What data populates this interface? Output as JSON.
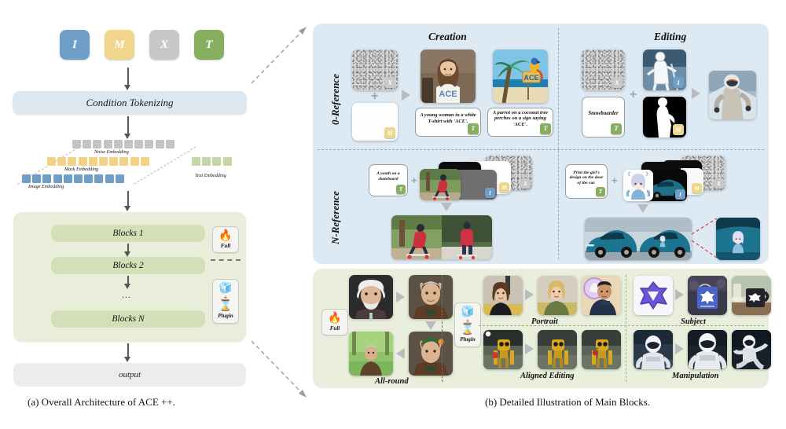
{
  "figure": {
    "caption_a": "(a) Overall Architecture of ACE ++.",
    "caption_b": "(b) Detailed Illustration of Main Blocks."
  },
  "architecture": {
    "tokens": [
      {
        "label": "I",
        "color": "#6f9fc8",
        "name": "image"
      },
      {
        "label": "M",
        "color": "#f0d58c",
        "name": "mask"
      },
      {
        "label": "X",
        "color": "#c8c8c8",
        "name": "noise"
      },
      {
        "label": "T",
        "color": "#85ae5e",
        "name": "text"
      }
    ],
    "condition_tokenizing": "Condition Tokenizing",
    "embeddings": [
      {
        "label": "Noise Embedding",
        "color": "#c3c3c3",
        "count": 10
      },
      {
        "label": "Mask Embedding",
        "color": "#f5d184",
        "count": 10
      },
      {
        "label": "Image Embedding",
        "color": "#6f9fc8",
        "count": 10
      },
      {
        "label": "Text Embedding",
        "color": "#c4d6a5",
        "count": 4
      }
    ],
    "blocks": [
      "Blocks 1",
      "Blocks 2",
      "...",
      "Blocks N"
    ],
    "output": "output",
    "badges": [
      {
        "label": "Full",
        "icons": [
          "🔥"
        ],
        "name": "full-finetune-badge"
      },
      {
        "label": "Plugin",
        "icons": [
          "🧊",
          "+",
          "⌛"
        ],
        "name": "plugin-badge"
      }
    ]
  },
  "detail": {
    "row_labels": [
      "0-Reference",
      "N-Reference"
    ],
    "column_titles": [
      "Creation",
      "Editing"
    ],
    "creation_zero_ref": {
      "inputs": [
        {
          "tag": "X",
          "tag_color": "#c8c8c8",
          "kind": "noise"
        },
        {
          "tag": "M",
          "tag_color": "#f0d58c",
          "kind": "white-mask"
        }
      ],
      "plus": "+",
      "results": [
        {
          "prompt": "A young woman in a white T-shirt with 'ACE'.",
          "tag": "T",
          "tag_color": "#85ae5e",
          "alt": "young woman in white ACE t-shirt"
        },
        {
          "prompt": "A parrot on a coconut tree perches on a sign saying 'ACE'.",
          "tag": "T",
          "tag_color": "#85ae5e",
          "alt": "parrot on coconut tree beach"
        }
      ]
    },
    "editing_zero_ref": {
      "inputs": [
        {
          "tag": "X",
          "tag_color": "#c8c8c8",
          "kind": "noise"
        },
        {
          "tag": "I",
          "tag_color": "#6f9fc8",
          "kind": "snowboarder-sketch"
        },
        {
          "tag": "T",
          "tag_color": "#85ae5e",
          "kind": "prompt",
          "prompt": "Snowboarder"
        },
        {
          "tag": "M",
          "tag_color": "#f0d58c",
          "kind": "binary-mask"
        }
      ],
      "plus": "+",
      "result_alt": "snowboarder with helmet and goggles"
    },
    "creation_n_ref": {
      "prompt": "A youth on a skateboard",
      "prompt_tag": "T",
      "plus": "+",
      "stack_tags": [
        "I",
        "M",
        "X"
      ],
      "result_alt": "skateboarder pair of generated frames"
    },
    "editing_n_ref": {
      "prompt": "Print the girl's design on the door of  the car.",
      "prompt_tag": "T",
      "plus": "+",
      "stack_tags": [
        "I",
        "M",
        "X"
      ],
      "result_alt": "blue sedan before and after decal with zoom inset"
    },
    "main_blocks": {
      "badges": [
        {
          "label": "Full",
          "icons": [
            "🔥"
          ],
          "name": "full-finetune-badge"
        },
        {
          "label": "Plugin",
          "icons": [
            "🧊",
            "+",
            "⌛"
          ],
          "name": "plugin-badge"
        }
      ],
      "categories": [
        {
          "label": "All-round",
          "count": 4
        },
        {
          "label": "Portrait",
          "count": 3
        },
        {
          "label": "Subject",
          "count": 3
        },
        {
          "label": "Aligned Editing",
          "count": 3
        },
        {
          "label": "Manipulation",
          "count": 3
        }
      ]
    }
  },
  "colors": {
    "panel_blue": "#dde9f3",
    "panel_green": "#e9efdc",
    "cond_box": "#dde7f0",
    "block_box": "#d4dfb8",
    "block_container": "#e8eeda",
    "output_box": "#ececec",
    "arrow_gray": "#b8bcc0"
  }
}
